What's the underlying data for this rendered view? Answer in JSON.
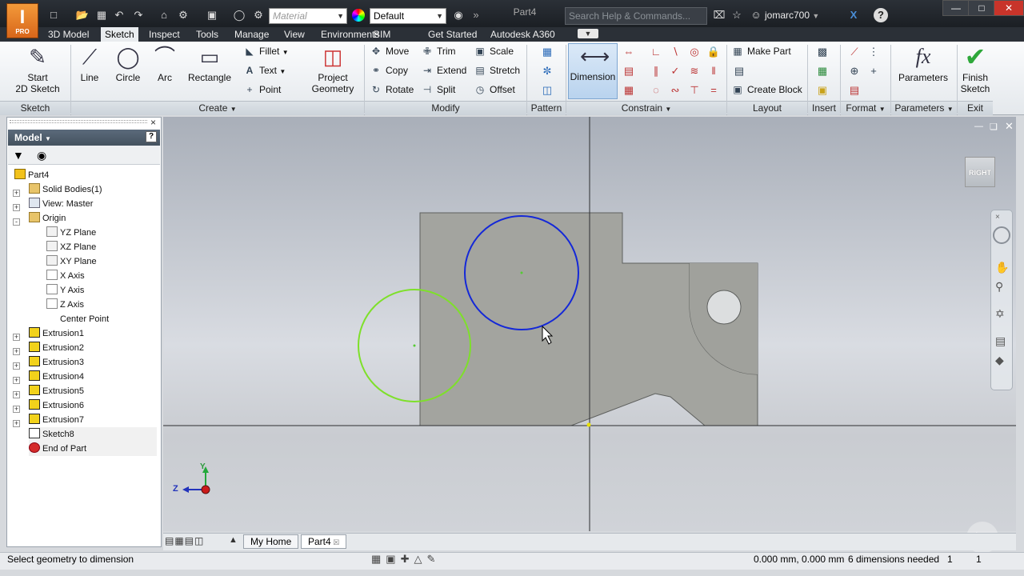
{
  "app": {
    "logo_text": "I",
    "logo_badge": "PRO",
    "document_title": "Part4"
  },
  "quick_access": {
    "material_value": "Material",
    "appearance_value": "Default",
    "search_placeholder": "Search Help & Commands...",
    "user_name": "jomarc700"
  },
  "ribbon_tabs": [
    "3D Model",
    "Sketch",
    "Inspect",
    "Tools",
    "Manage",
    "View",
    "Environments",
    "BIM",
    "Get Started",
    "Autodesk A360"
  ],
  "active_tab": "Sketch",
  "ribbon": {
    "sketch_group": {
      "label": "Sketch",
      "start_sketch": "Start\n2D Sketch"
    },
    "create_group": {
      "label": "Create",
      "line": "Line",
      "circle": "Circle",
      "arc": "Arc",
      "rectangle": "Rectangle",
      "fillet": "Fillet",
      "text": "Text",
      "point": "Point",
      "project_geometry": "Project\nGeometry"
    },
    "modify_group": {
      "label": "Modify",
      "move": "Move",
      "copy": "Copy",
      "rotate": "Rotate",
      "trim": "Trim",
      "extend": "Extend",
      "split": "Split",
      "scale": "Scale",
      "stretch": "Stretch",
      "offset": "Offset"
    },
    "pattern_group": {
      "label": "Pattern"
    },
    "constrain_group": {
      "label": "Constrain",
      "dimension": "Dimension"
    },
    "layout_group": {
      "label": "Layout",
      "make_part": "Make Part",
      "create_block": "Create Block"
    },
    "insert_group": {
      "label": "Insert"
    },
    "format_group": {
      "label": "Format"
    },
    "parameters_group": {
      "label": "Parameters",
      "parameters": "Parameters"
    },
    "exit_group": {
      "label": "Exit",
      "finish_sketch": "Finish\nSketch"
    }
  },
  "browser": {
    "title": "Model",
    "items": [
      {
        "label": "Part4",
        "depth": 0,
        "icon": "part-icon",
        "expander": ""
      },
      {
        "label": "Solid Bodies(1)",
        "depth": 1,
        "icon": "folder-icon",
        "expander": "+"
      },
      {
        "label": "View: Master",
        "depth": 1,
        "icon": "view-icon",
        "expander": "+"
      },
      {
        "label": "Origin",
        "depth": 1,
        "icon": "folder-icon",
        "expander": "-"
      },
      {
        "label": "YZ Plane",
        "depth": 2,
        "icon": "plane-icon",
        "expander": ""
      },
      {
        "label": "XZ Plane",
        "depth": 2,
        "icon": "plane-icon",
        "expander": ""
      },
      {
        "label": "XY Plane",
        "depth": 2,
        "icon": "plane-icon",
        "expander": ""
      },
      {
        "label": "X Axis",
        "depth": 2,
        "icon": "axis-icon",
        "expander": ""
      },
      {
        "label": "Y Axis",
        "depth": 2,
        "icon": "axis-icon",
        "expander": ""
      },
      {
        "label": "Z Axis",
        "depth": 2,
        "icon": "axis-icon",
        "expander": ""
      },
      {
        "label": "Center Point",
        "depth": 2,
        "icon": "point-icon",
        "expander": ""
      },
      {
        "label": "Extrusion1",
        "depth": 1,
        "icon": "extrusion-icon",
        "expander": "+"
      },
      {
        "label": "Extrusion2",
        "depth": 1,
        "icon": "extrusion-icon",
        "expander": "+"
      },
      {
        "label": "Extrusion3",
        "depth": 1,
        "icon": "extrusion-icon",
        "expander": "+"
      },
      {
        "label": "Extrusion4",
        "depth": 1,
        "icon": "extrusion-icon",
        "expander": "+"
      },
      {
        "label": "Extrusion5",
        "depth": 1,
        "icon": "extrusion-icon",
        "expander": "+"
      },
      {
        "label": "Extrusion6",
        "depth": 1,
        "icon": "extrusion-icon",
        "expander": "+"
      },
      {
        "label": "Extrusion7",
        "depth": 1,
        "icon": "extrusion-icon",
        "expander": "+"
      },
      {
        "label": "Sketch8",
        "depth": 1,
        "icon": "sketch-icon",
        "expander": ""
      },
      {
        "label": "End of Part",
        "depth": 1,
        "icon": "end-of-part-icon",
        "expander": ""
      }
    ]
  },
  "viewport": {
    "view_cube_label": "RIGHT",
    "axis_z": "Z",
    "axis_y": "Y",
    "colors": {
      "selected_circle": "#1428d8",
      "preview_circle": "#7ee02a"
    }
  },
  "document_tabs": [
    "My Home",
    "Part4"
  ],
  "active_document": "Part4",
  "status_bar": {
    "prompt": "Select geometry to dimension",
    "coordinates": "0.000 mm, 0.000 mm",
    "dimensions_needed": "6 dimensions needed",
    "count_a": "1",
    "count_b": "1"
  }
}
